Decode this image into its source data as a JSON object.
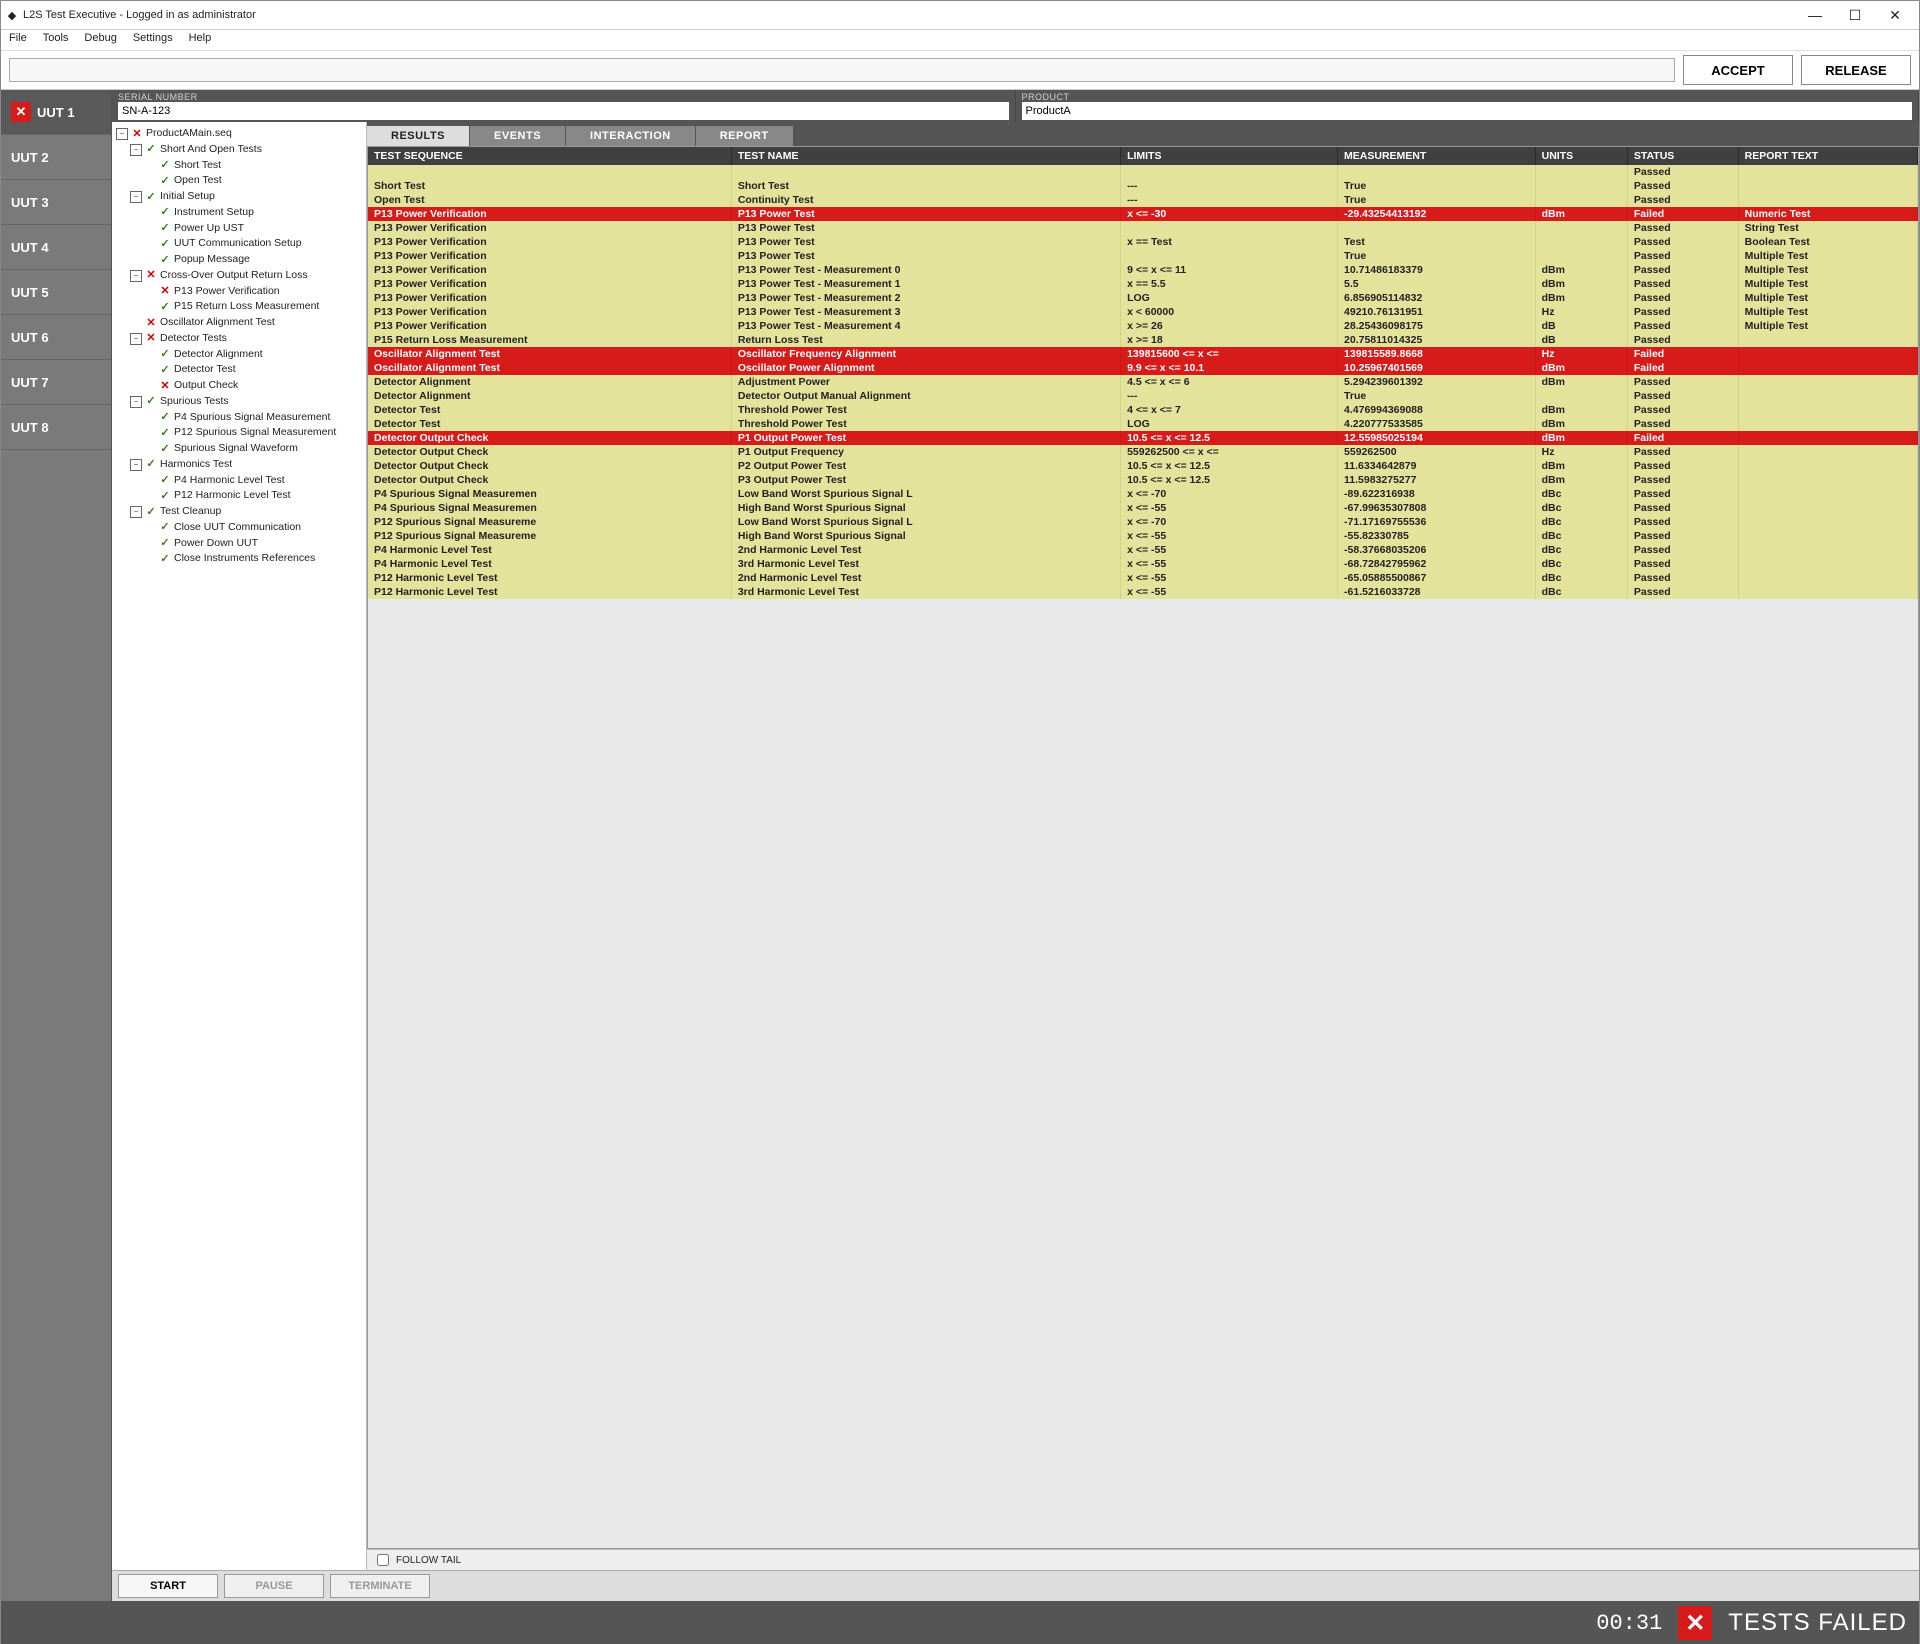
{
  "window": {
    "title": "L2S Test Executive - Logged in as administrator",
    "min": "—",
    "max": "☐",
    "close": "✕"
  },
  "menu": [
    "File",
    "Tools",
    "Debug",
    "Settings",
    "Help"
  ],
  "actionbar": {
    "accept": "ACCEPT",
    "release": "RELEASE"
  },
  "info": {
    "serial_label": "SERIAL NUMBER",
    "serial_value": "SN-A-123",
    "product_label": "PRODUCT",
    "product_value": "ProductA"
  },
  "uuts": [
    {
      "label": "UUT 1",
      "active": true,
      "failed": true
    },
    {
      "label": "UUT 2",
      "active": false,
      "failed": false
    },
    {
      "label": "UUT 3",
      "active": false,
      "failed": false
    },
    {
      "label": "UUT 4",
      "active": false,
      "failed": false
    },
    {
      "label": "UUT 5",
      "active": false,
      "failed": false
    },
    {
      "label": "UUT 6",
      "active": false,
      "failed": false
    },
    {
      "label": "UUT 7",
      "active": false,
      "failed": false
    },
    {
      "label": "UUT 8",
      "active": false,
      "failed": false
    }
  ],
  "tree": [
    {
      "l": "ProductAMain.seq",
      "s": "fail",
      "c": [
        {
          "l": "Short And Open Tests",
          "s": "pass",
          "c": [
            {
              "l": "Short Test",
              "s": "pass"
            },
            {
              "l": "Open Test",
              "s": "pass"
            }
          ]
        },
        {
          "l": "Initial Setup",
          "s": "pass",
          "c": [
            {
              "l": "Instrument Setup",
              "s": "pass"
            },
            {
              "l": "Power Up UST",
              "s": "pass"
            },
            {
              "l": "UUT Communication Setup",
              "s": "pass"
            },
            {
              "l": "Popup Message",
              "s": "pass"
            }
          ]
        },
        {
          "l": "Cross-Over Output Return Loss",
          "s": "fail",
          "c": [
            {
              "l": "P13 Power Verification",
              "s": "fail"
            },
            {
              "l": "P15 Return Loss Measurement",
              "s": "pass"
            }
          ]
        },
        {
          "l": "Oscillator Alignment Test",
          "s": "fail"
        },
        {
          "l": "Detector Tests",
          "s": "fail",
          "c": [
            {
              "l": "Detector Alignment",
              "s": "pass"
            },
            {
              "l": "Detector Test",
              "s": "pass"
            },
            {
              "l": "Output Check",
              "s": "fail"
            }
          ]
        },
        {
          "l": "Spurious Tests",
          "s": "pass",
          "c": [
            {
              "l": "P4 Spurious Signal Measurement",
              "s": "pass"
            },
            {
              "l": "P12 Spurious Signal Measurement",
              "s": "pass"
            },
            {
              "l": "Spurious Signal Waveform",
              "s": "pass"
            }
          ]
        },
        {
          "l": "Harmonics Test",
          "s": "pass",
          "c": [
            {
              "l": "P4 Harmonic Level Test",
              "s": "pass"
            },
            {
              "l": "P12 Harmonic Level Test",
              "s": "pass"
            }
          ]
        },
        {
          "l": "Test Cleanup",
          "s": "pass",
          "c": [
            {
              "l": "Close UUT Communication",
              "s": "pass"
            },
            {
              "l": "Power Down UUT",
              "s": "pass"
            },
            {
              "l": "Close Instruments References",
              "s": "pass"
            }
          ]
        }
      ]
    }
  ],
  "tabs": {
    "results": "RESULTS",
    "events": "EVENTS",
    "interaction": "INTERACTION",
    "report": "REPORT"
  },
  "columns": [
    "TEST SEQUENCE",
    "TEST NAME",
    "LIMITS",
    "MEASUREMENT",
    "UNITS",
    "STATUS",
    "REPORT TEXT"
  ],
  "rows": [
    {
      "st": "Passed",
      "seq": "",
      "name": "",
      "lim": "",
      "meas": "",
      "u": "",
      "rt": ""
    },
    {
      "st": "Passed",
      "seq": "Short Test",
      "name": "Short Test",
      "lim": "---",
      "meas": "True",
      "u": "",
      "rt": ""
    },
    {
      "st": "Passed",
      "seq": "Open Test",
      "name": "Continuity Test",
      "lim": "---",
      "meas": "True",
      "u": "",
      "rt": ""
    },
    {
      "st": "Failed",
      "seq": "P13 Power Verification",
      "name": "P13 Power Test",
      "lim": "x <= -30",
      "meas": "-29.43254413192",
      "u": "dBm",
      "rt": "Numeric Test"
    },
    {
      "st": "Passed",
      "seq": "P13 Power Verification",
      "name": "P13 Power Test",
      "lim": "",
      "meas": "",
      "u": "",
      "rt": "String Test"
    },
    {
      "st": "Passed",
      "seq": "P13 Power Verification",
      "name": "P13 Power Test",
      "lim": "x == Test",
      "meas": "Test",
      "u": "",
      "rt": "Boolean Test"
    },
    {
      "st": "Passed",
      "seq": "P13 Power Verification",
      "name": "P13 Power Test",
      "lim": "",
      "meas": "True",
      "u": "",
      "rt": "Multiple Test"
    },
    {
      "st": "Passed",
      "seq": "P13 Power Verification",
      "name": "P13 Power Test - Measurement 0",
      "lim": "9 <= x <= 11",
      "meas": "10.71486183379",
      "u": "dBm",
      "rt": "Multiple Test"
    },
    {
      "st": "Passed",
      "seq": "P13 Power Verification",
      "name": "P13 Power Test - Measurement 1",
      "lim": "x == 5.5",
      "meas": "5.5",
      "u": "dBm",
      "rt": "Multiple Test"
    },
    {
      "st": "Passed",
      "seq": "P13 Power Verification",
      "name": "P13 Power Test - Measurement 2",
      "lim": "LOG",
      "meas": "6.856905114832",
      "u": "dBm",
      "rt": "Multiple Test"
    },
    {
      "st": "Passed",
      "seq": "P13 Power Verification",
      "name": "P13 Power Test - Measurement 3",
      "lim": "x < 60000",
      "meas": "49210.76131951",
      "u": "Hz",
      "rt": "Multiple Test"
    },
    {
      "st": "Passed",
      "seq": "P13 Power Verification",
      "name": "P13 Power Test - Measurement 4",
      "lim": "x >= 26",
      "meas": "28.25436098175",
      "u": "dB",
      "rt": "Multiple Test"
    },
    {
      "st": "Passed",
      "seq": "P15 Return Loss Measurement",
      "name": "Return Loss Test",
      "lim": "x >= 18",
      "meas": "20.75811014325",
      "u": "dB",
      "rt": ""
    },
    {
      "st": "Failed",
      "seq": "Oscillator Alignment Test",
      "name": "Oscillator Frequency Alignment",
      "lim": "139815600 <= x <=",
      "meas": "139815589.8668",
      "u": "Hz",
      "rt": ""
    },
    {
      "st": "Failed",
      "seq": "Oscillator Alignment Test",
      "name": "Oscillator Power Alignment",
      "lim": "9.9 <= x <= 10.1",
      "meas": "10.25967401569",
      "u": "dBm",
      "rt": ""
    },
    {
      "st": "Passed",
      "seq": "Detector Alignment",
      "name": "Adjustment Power",
      "lim": "4.5 <= x <= 6",
      "meas": "5.294239601392",
      "u": "dBm",
      "rt": ""
    },
    {
      "st": "Passed",
      "seq": "Detector Alignment",
      "name": "Detector Output Manual Alignment",
      "lim": "---",
      "meas": "True",
      "u": "",
      "rt": ""
    },
    {
      "st": "Passed",
      "seq": "Detector Test",
      "name": "Threshold Power Test",
      "lim": "4 <= x <= 7",
      "meas": "4.476994369088",
      "u": "dBm",
      "rt": ""
    },
    {
      "st": "Passed",
      "seq": "Detector Test",
      "name": "Threshold Power Test",
      "lim": "LOG",
      "meas": "4.220777533585",
      "u": "dBm",
      "rt": ""
    },
    {
      "st": "Failed",
      "seq": "Detector Output Check",
      "name": "P1 Output Power Test",
      "lim": "10.5 <= x <= 12.5",
      "meas": "12.55985025194",
      "u": "dBm",
      "rt": ""
    },
    {
      "st": "Passed",
      "seq": "Detector Output Check",
      "name": "P1 Output Frequency",
      "lim": "559262500 <= x <=",
      "meas": "559262500",
      "u": "Hz",
      "rt": ""
    },
    {
      "st": "Passed",
      "seq": "Detector Output Check",
      "name": "P2 Output Power Test",
      "lim": "10.5 <= x <= 12.5",
      "meas": "11.6334642879",
      "u": "dBm",
      "rt": ""
    },
    {
      "st": "Passed",
      "seq": "Detector Output Check",
      "name": "P3 Output Power Test",
      "lim": "10.5 <= x <= 12.5",
      "meas": "11.5983275277",
      "u": "dBm",
      "rt": ""
    },
    {
      "st": "Passed",
      "seq": "P4 Spurious Signal Measuremen",
      "name": "Low Band Worst Spurious Signal L",
      "lim": "x <= -70",
      "meas": "-89.622316938",
      "u": "dBc",
      "rt": ""
    },
    {
      "st": "Passed",
      "seq": "P4 Spurious Signal Measuremen",
      "name": "High Band Worst Spurious Signal",
      "lim": "x <= -55",
      "meas": "-67.99635307808",
      "u": "dBc",
      "rt": ""
    },
    {
      "st": "Passed",
      "seq": "P12 Spurious Signal Measureme",
      "name": "Low Band Worst Spurious Signal L",
      "lim": "x <= -70",
      "meas": "-71.17169755536",
      "u": "dBc",
      "rt": ""
    },
    {
      "st": "Passed",
      "seq": "P12 Spurious Signal Measureme",
      "name": "High Band Worst Spurious Signal",
      "lim": "x <= -55",
      "meas": "-55.82330785",
      "u": "dBc",
      "rt": ""
    },
    {
      "st": "Passed",
      "seq": "P4 Harmonic Level Test",
      "name": "2nd Harmonic Level Test",
      "lim": "x <= -55",
      "meas": "-58.37668035206",
      "u": "dBc",
      "rt": ""
    },
    {
      "st": "Passed",
      "seq": "P4 Harmonic Level Test",
      "name": "3rd Harmonic Level Test",
      "lim": "x <= -55",
      "meas": "-68.72842795962",
      "u": "dBc",
      "rt": ""
    },
    {
      "st": "Passed",
      "seq": "P12 Harmonic Level Test",
      "name": "2nd Harmonic Level Test",
      "lim": "x <= -55",
      "meas": "-65.05885500867",
      "u": "dBc",
      "rt": ""
    },
    {
      "st": "Passed",
      "seq": "P12 Harmonic Level Test",
      "name": "3rd Harmonic Level Test",
      "lim": "x <= -55",
      "meas": "-61.5216033728",
      "u": "dBc",
      "rt": ""
    }
  ],
  "follow_label": "FOLLOW TAIL",
  "controls": {
    "start": "START",
    "pause": "PAUSE",
    "terminate": "TERMINATE"
  },
  "status": {
    "timer": "00:31",
    "msg": "TESTS FAILED"
  }
}
